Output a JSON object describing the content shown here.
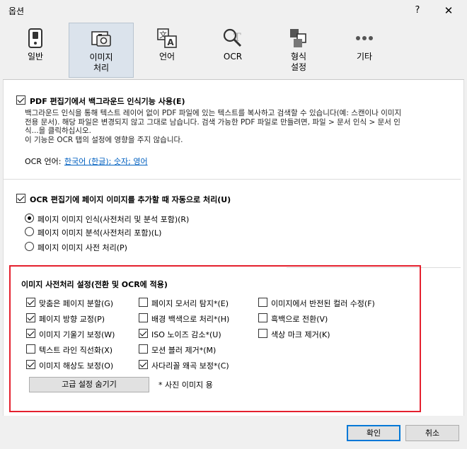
{
  "window": {
    "title": "옵션",
    "help": "?",
    "close": "✕"
  },
  "tabs": [
    {
      "label": "일반",
      "icon": "toggle-switch-icon"
    },
    {
      "label": "이미지\n처리",
      "icon": "image-camera-icon",
      "active": true
    },
    {
      "label": "언어",
      "icon": "translate-icon"
    },
    {
      "label": "OCR",
      "icon": "ocr-magnifier-icon"
    },
    {
      "label": "형식\n설정",
      "icon": "format-documents-icon"
    },
    {
      "label": "기타",
      "icon": "more-dots-icon"
    }
  ],
  "pdf_section": {
    "checkbox_label": "PDF 편집기에서 백그라운드 인식기능 사용(E)",
    "checked": true,
    "desc1": "백그라운드 인식을 통해 텍스트 레이어 없이 PDF 파일에 있는 텍스트를 복사하고 검색할 수 있습니다(예: 스캔이나 이미지",
    "desc2": "전용 문서). 해당 파일은 변경되지 않고 그대로 남습니다. 검색 가능한 PDF 파일로 만들려면, 파일 > 문서 인식 > 문서 인",
    "desc3": "식...을 클릭하십시오.",
    "desc4": "이 기능은 OCR 탭의 설정에 영향을 주지 않습니다.",
    "ocr_lang_label": "OCR 언어:",
    "ocr_lang_link": "한국어 (한글); 숫자; 영어"
  },
  "ocr_section": {
    "checkbox_label": "OCR 편집기에 페이지 이미지를 추가할 때 자동으로 처리(U)",
    "checked": true,
    "radios": [
      {
        "label": "페이지 이미지 인식(사전처리 및 분석 포함)(R)",
        "checked": true
      },
      {
        "label": "페이지 이미지 분석(사전처리 포함)(L)",
        "checked": false
      },
      {
        "label": "페이지 이미지 사전 처리(P)",
        "checked": false
      }
    ]
  },
  "preprocess": {
    "title": "이미지 사전처리 설정(전환 및 OCR에 적용)",
    "col1": [
      {
        "label": "맞춤은 페이지 분할(G)",
        "checked": true
      },
      {
        "label": "페이지 방향 교정(P)",
        "checked": true
      },
      {
        "label": "이미지 기울기 보정(W)",
        "checked": true
      },
      {
        "label": "텍스트 라인 직선화(X)",
        "checked": false
      },
      {
        "label": "이미지 해상도 보정(O)",
        "checked": true
      }
    ],
    "col2": [
      {
        "label": "페이지 모서리 탐지*(E)",
        "checked": false
      },
      {
        "label": "배경 백색으로 처리*(H)",
        "checked": false
      },
      {
        "label": "ISO 노이즈 감소*(U)",
        "checked": true
      },
      {
        "label": "모션 블러 제거*(M)",
        "checked": false
      },
      {
        "label": "사다리꼴 왜곡 보정*(C)",
        "checked": true
      }
    ],
    "col3": [
      {
        "label": "이미지에서 반전된 컬러 수정(F)",
        "checked": false
      },
      {
        "label": "흑백으로 전환(V)",
        "checked": false
      },
      {
        "label": "색상 마크 제거(K)",
        "checked": false
      }
    ],
    "advanced_button": "고급 설정 숨기기",
    "footnote": "* 사진 이미지 용"
  },
  "footer": {
    "ok": "확인",
    "cancel": "취소"
  }
}
